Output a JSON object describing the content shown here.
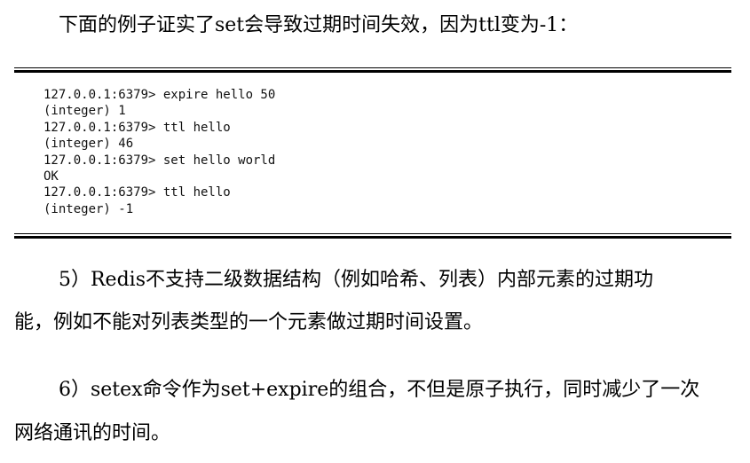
{
  "intro": "下面的例子证实了set会导致过期时间失效，因为ttl变为-1：",
  "code_lines": [
    "127.0.0.1:6379> expire hello 50",
    "(integer) 1",
    "127.0.0.1:6379> ttl hello",
    "(integer) 46",
    "127.0.0.1:6379> set hello world",
    "OK",
    "127.0.0.1:6379> ttl hello",
    "(integer) -1"
  ],
  "paragraph5": {
    "line1": "5）Redis不支持二级数据结构（例如哈希、列表）内部元素的过期功",
    "line2": "能，例如不能对列表类型的一个元素做过期时间设置。"
  },
  "paragraph6": {
    "line1": "6）setex命令作为set+expire的组合，不但是原子执行，同时减少了一次",
    "line2": "网络通讯的时间。"
  }
}
